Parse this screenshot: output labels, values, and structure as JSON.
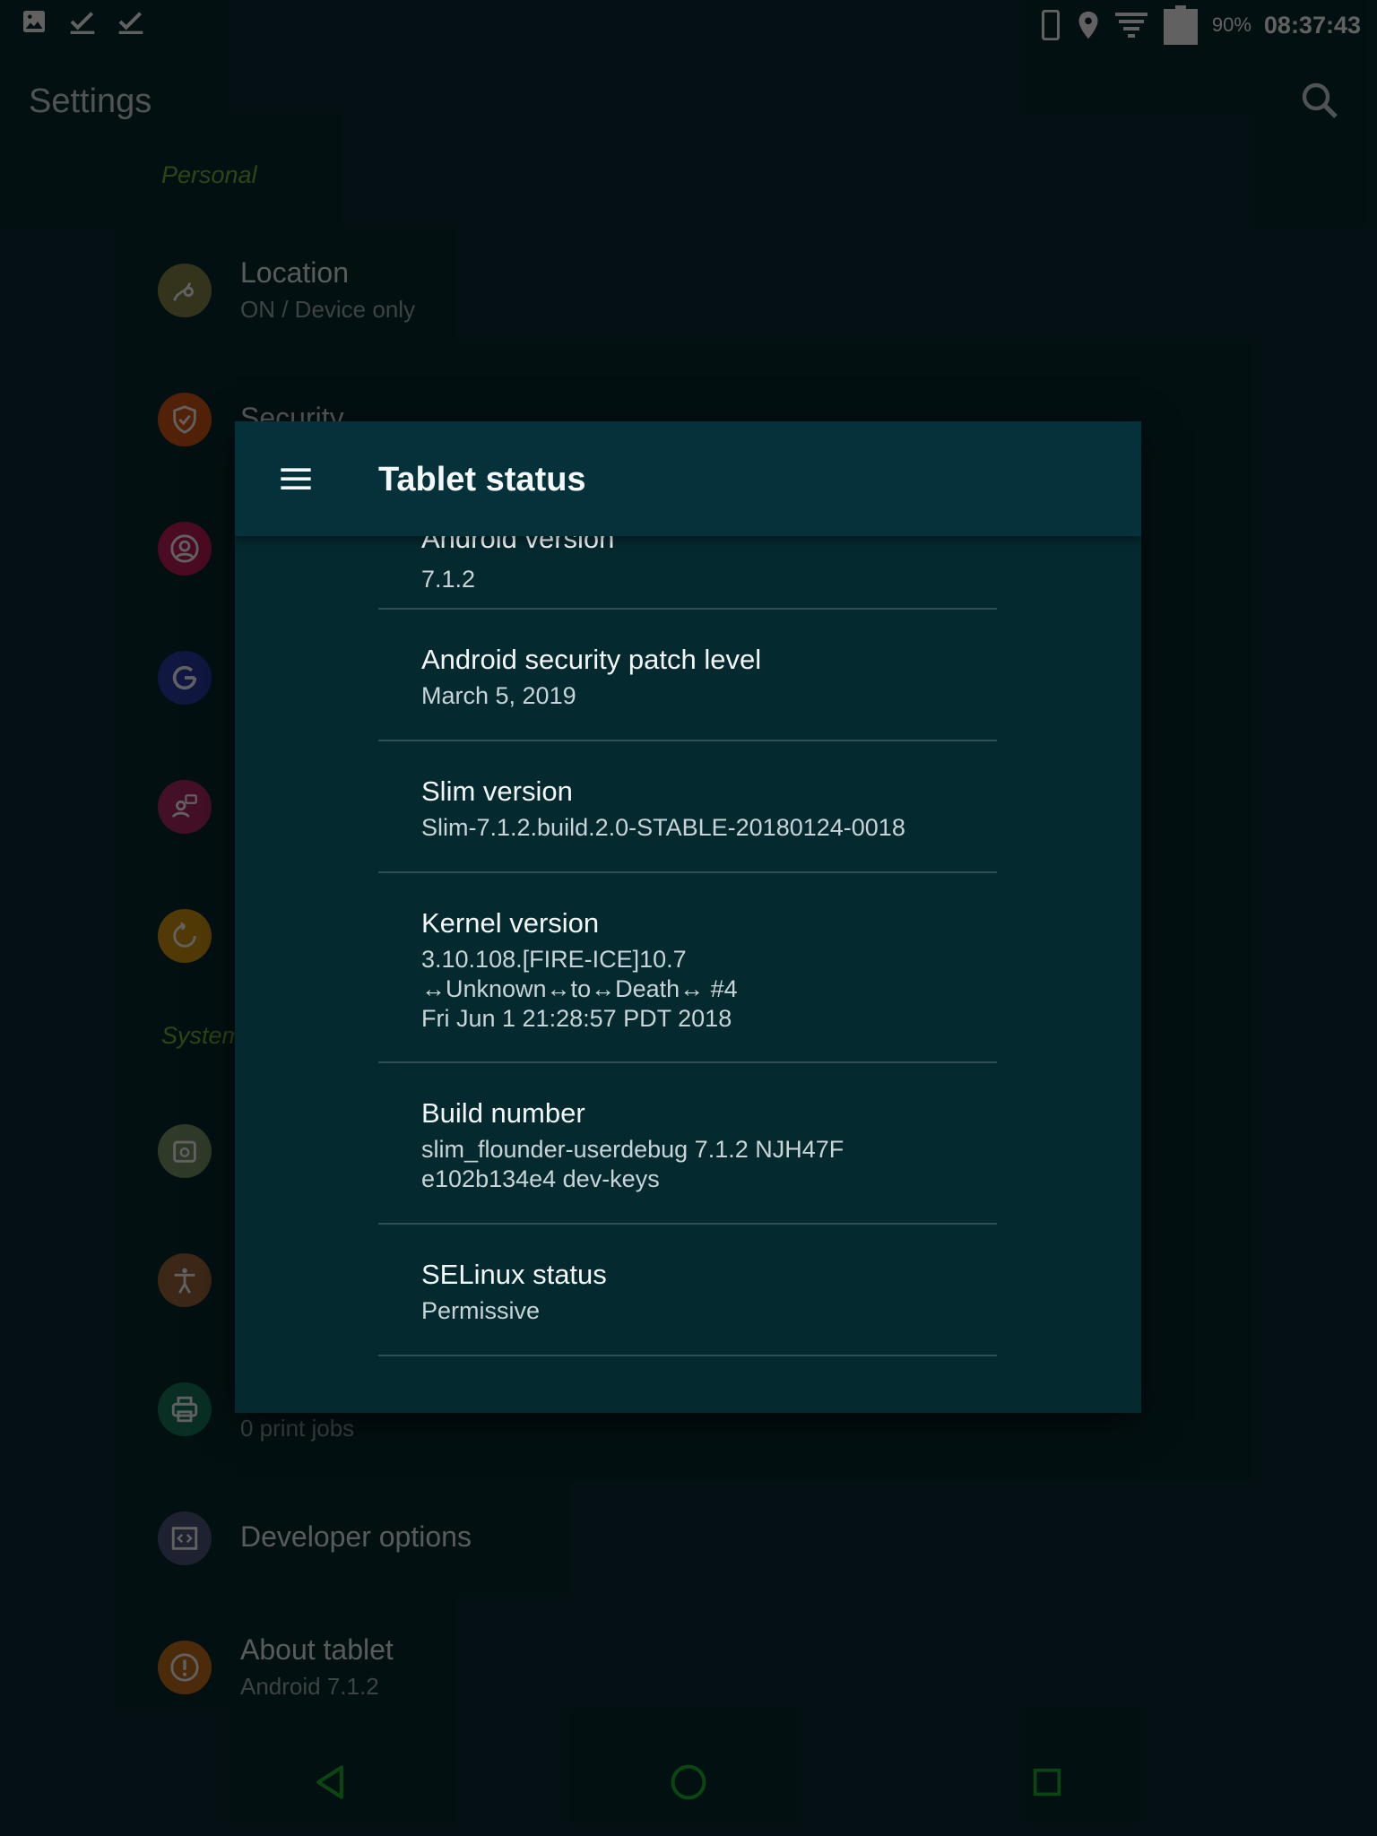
{
  "status_bar": {
    "notification_icons": [
      "image-icon",
      "check-icon",
      "check-icon"
    ],
    "system_icons": [
      "tablet-icon",
      "location-pin-icon",
      "signal-filter-icon",
      "battery-icon"
    ],
    "battery_percent": "90%",
    "time": "08:37:43"
  },
  "app_bar": {
    "title": "Settings",
    "search_icon": "search-icon"
  },
  "settings": {
    "personal_header": "Personal",
    "system_header": "System",
    "items": [
      {
        "title": "Location",
        "summary": "ON / Device only",
        "icon": "location-icon",
        "color": "#8a8a4a"
      },
      {
        "title": "Security",
        "summary": "",
        "icon": "shield-icon",
        "color": "#d75b17"
      },
      {
        "title": "",
        "summary": "",
        "icon": "account-icon",
        "color": "#c41d59"
      },
      {
        "title": "",
        "summary": "",
        "icon": "google-icon",
        "color": "#2c3dac"
      },
      {
        "title": "",
        "summary": "",
        "icon": "language-icon",
        "color": "#b12a6b"
      },
      {
        "title": "",
        "summary": "",
        "icon": "backup-icon",
        "color": "#d49a12"
      },
      {
        "title": "",
        "summary": "",
        "icon": "date-time-icon",
        "color": "#7e9a6b"
      },
      {
        "title": "",
        "summary": "",
        "icon": "accessibility-icon",
        "color": "#a0683a"
      },
      {
        "title": "",
        "summary": "0 print jobs",
        "icon": "print-icon",
        "color": "#1a7c60"
      },
      {
        "title": "Developer options",
        "summary": "",
        "icon": "developer-icon",
        "color": "#505a7e"
      },
      {
        "title": "About tablet",
        "summary": "Android 7.1.2",
        "icon": "info-icon",
        "color": "#c8711e"
      }
    ]
  },
  "dialog": {
    "title": "Tablet status",
    "menu_icon": "menu-icon",
    "items": [
      {
        "label": "Android version",
        "value": [
          "7.1.2"
        ]
      },
      {
        "label": "Android security patch level",
        "value": [
          "March 5, 2019"
        ]
      },
      {
        "label": "Slim version",
        "value": [
          "Slim-7.1.2.build.2.0-STABLE-20180124-0018"
        ]
      },
      {
        "label": "Kernel version",
        "value": [
          "3.10.108.[FIRE-ICE]10.7",
          "↔Unknown↔to↔Death↔ #4",
          "Fri Jun 1 21:28:57 PDT 2018"
        ]
      },
      {
        "label": "Build number",
        "value": [
          "slim_flounder-userdebug 7.1.2 NJH47F",
          "e102b134e4 dev-keys"
        ]
      },
      {
        "label": "SELinux status",
        "value": [
          "Permissive"
        ]
      }
    ]
  },
  "nav_bar": {
    "back_icon": "back-icon",
    "home_icon": "home-icon",
    "recents_icon": "recents-icon",
    "color": "#19b82a"
  }
}
